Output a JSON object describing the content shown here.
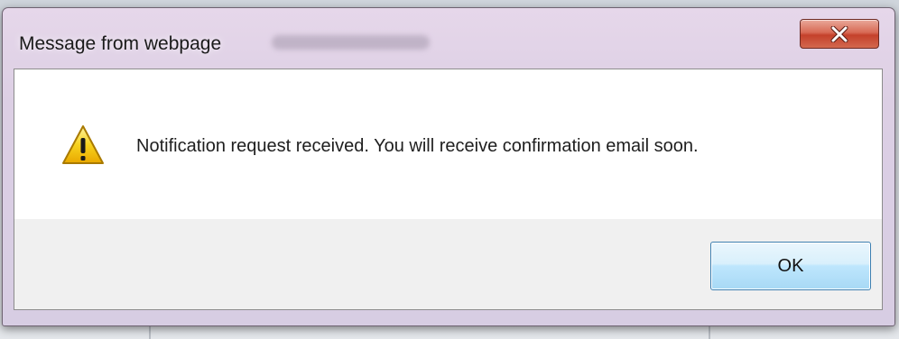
{
  "window": {
    "title": "Message from webpage",
    "close_icon": "close-x-icon",
    "close_button_color": "#c4412b"
  },
  "message": {
    "icon": "warning-triangle-icon",
    "icon_color": "#f2c200",
    "text": "Notification request received. You will receive confirmation email soon."
  },
  "buttons": {
    "ok_label": "OK",
    "ok_color": "#bee6fd"
  }
}
